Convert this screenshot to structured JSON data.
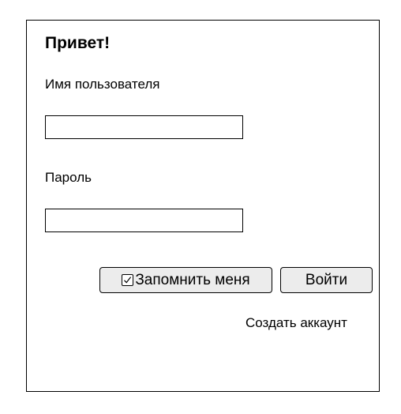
{
  "form": {
    "greeting": "Привет!",
    "username": {
      "label": "Имя пользователя",
      "value": ""
    },
    "password": {
      "label": "Пароль",
      "value": ""
    },
    "remember_me": {
      "label": "Запомнить меня",
      "checked": true
    },
    "login_label": "Войти",
    "create_account_label": "Создать аккаунт"
  },
  "icons": {
    "remember_checkbox": "checkbox-checked-icon"
  }
}
